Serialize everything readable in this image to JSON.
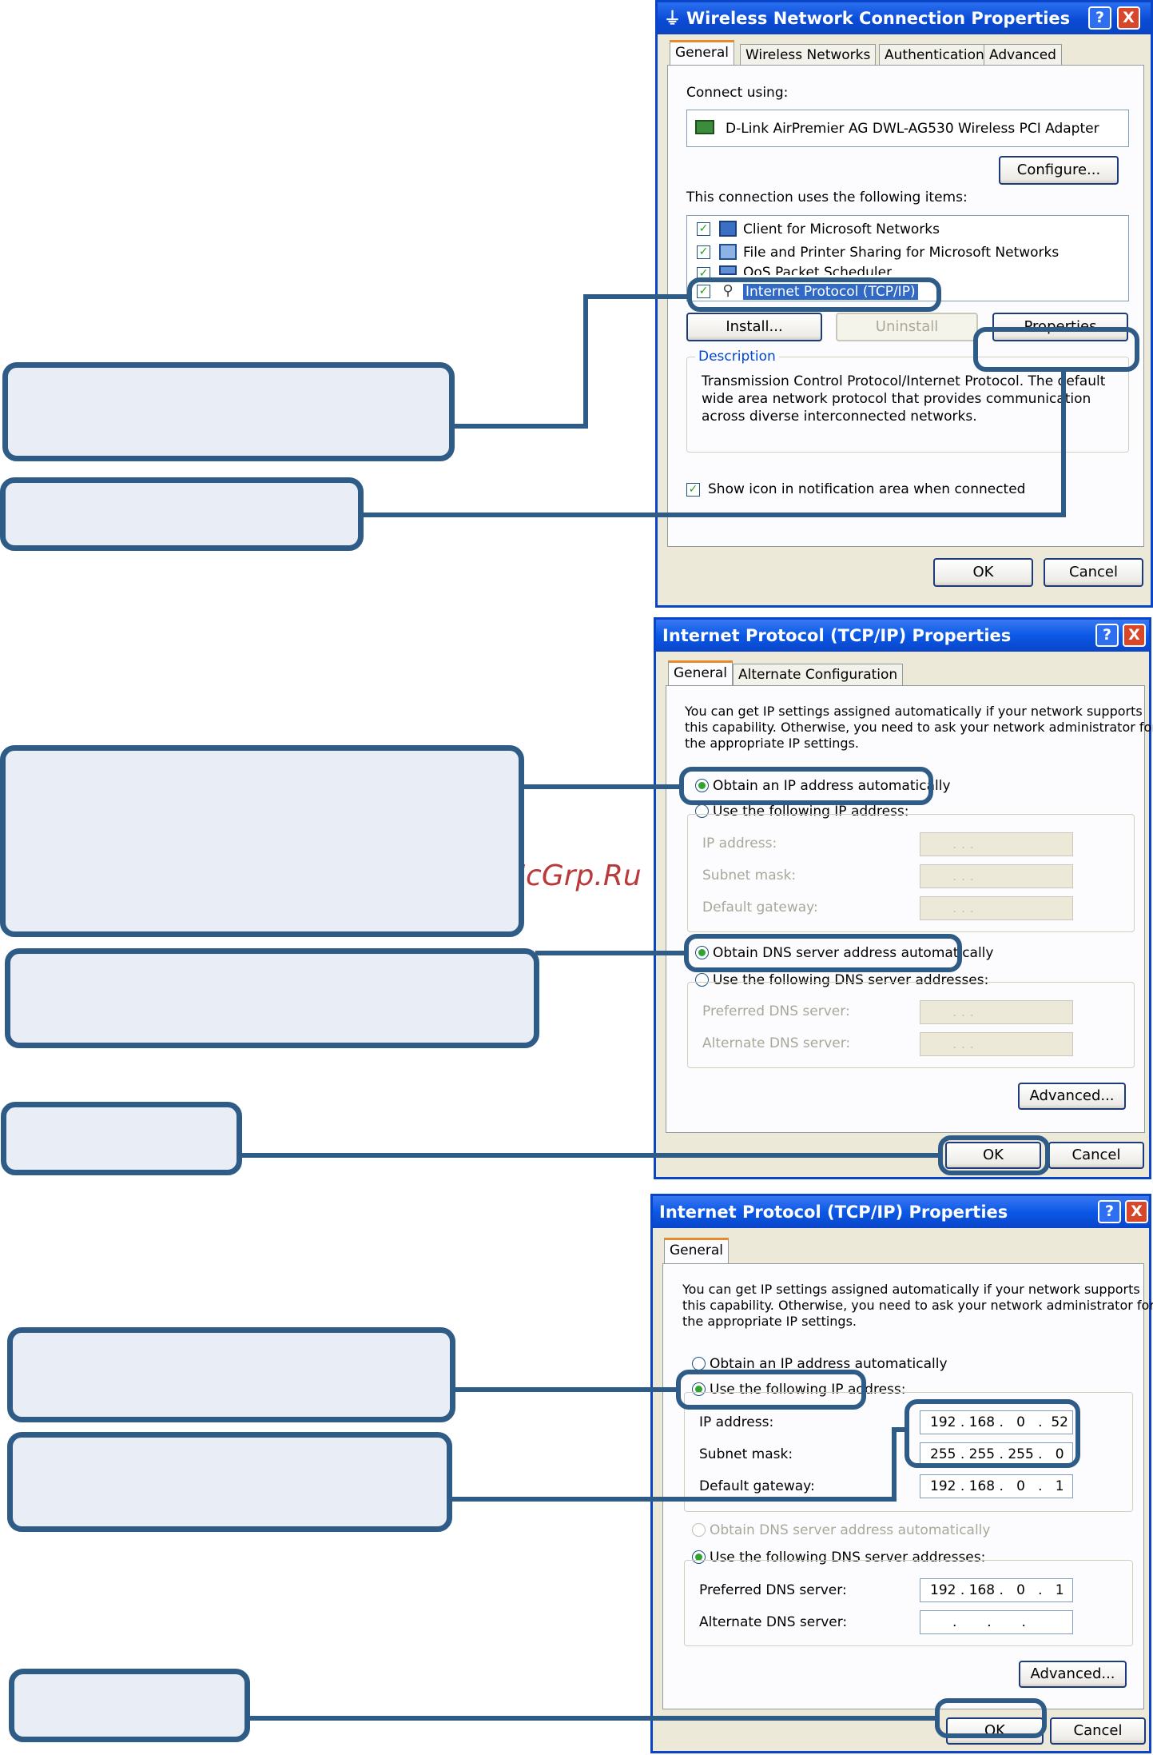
{
  "watermark": "McGrp.Ru",
  "dialog1": {
    "title": "Wireless Network Connection Properties",
    "help_glyph": "?",
    "close_glyph": "X",
    "tabs": [
      "General",
      "Wireless Networks",
      "Authentication",
      "Advanced"
    ],
    "connect_using_label": "Connect using:",
    "adapter": "D-Link AirPremier AG DWL-AG530 Wireless PCI Adapter",
    "configure_button": "Configure...",
    "items_label": "This connection uses the following items:",
    "items": [
      {
        "label": "Client for Microsoft Networks",
        "checked": true,
        "icon": "client-icon"
      },
      {
        "label": "File and Printer Sharing for Microsoft Networks",
        "checked": true,
        "icon": "share-icon"
      },
      {
        "label": "QoS Packet Scheduler",
        "checked": true,
        "icon": "qos-icon"
      },
      {
        "label": "Internet Protocol (TCP/IP)",
        "checked": true,
        "icon": "network-protocol-icon",
        "selected": true
      }
    ],
    "install_button": "Install...",
    "uninstall_button": "Uninstall",
    "properties_button": "Properties",
    "description_label": "Description",
    "description_text": [
      "Transmission Control Protocol/Internet Protocol. The default",
      "wide area network protocol that provides communication",
      "across diverse interconnected networks."
    ],
    "show_icon_label": "Show icon in notification area when connected",
    "ok_button": "OK",
    "cancel_button": "Cancel"
  },
  "dialog2": {
    "title": "Internet Protocol (TCP/IP) Properties",
    "help_glyph": "?",
    "close_glyph": "X",
    "tabs": [
      "General",
      "Alternate Configuration"
    ],
    "intro": [
      "You can get IP settings assigned automatically if your network supports",
      "this capability. Otherwise, you need to ask your network administrator for",
      "the appropriate IP settings."
    ],
    "obtain_ip_auto": "Obtain an IP address automatically",
    "use_following_ip": "Use the following IP address:",
    "ip_address_label": "IP address:",
    "subnet_mask_label": "Subnet mask:",
    "default_gateway_label": "Default gateway:",
    "empty_ip": ".       .       .",
    "obtain_dns_auto": "Obtain DNS server address automatically",
    "use_following_dns": "Use the following DNS server addresses:",
    "preferred_dns_label": "Preferred DNS server:",
    "alternate_dns_label": "Alternate DNS server:",
    "advanced_button": "Advanced...",
    "ok_button": "OK",
    "cancel_button": "Cancel"
  },
  "dialog3": {
    "title": "Internet Protocol (TCP/IP) Properties",
    "help_glyph": "?",
    "close_glyph": "X",
    "tabs": [
      "General"
    ],
    "intro": [
      "You can get IP settings assigned automatically if your network supports",
      "this capability. Otherwise, you need to ask your network administrator for",
      "the appropriate IP settings."
    ],
    "obtain_ip_auto": "Obtain an IP address automatically",
    "use_following_ip": "Use the following IP address:",
    "ip_address_label": "IP address:",
    "ip_address": "192 . 168 .   0   .  52",
    "subnet_mask_label": "Subnet mask:",
    "subnet_mask": "255 . 255 . 255 .   0",
    "default_gateway_label": "Default gateway:",
    "default_gateway": "192 . 168 .   0   .   1",
    "obtain_dns_auto": "Obtain DNS server address automatically",
    "use_following_dns": "Use the following DNS server addresses:",
    "preferred_dns_label": "Preferred DNS server:",
    "preferred_dns": "192 . 168 .   0   .   1",
    "alternate_dns_label": "Alternate DNS server:",
    "alternate_dns": ".       .       .",
    "advanced_button": "Advanced...",
    "ok_button": "OK",
    "cancel_button": "Cancel"
  }
}
